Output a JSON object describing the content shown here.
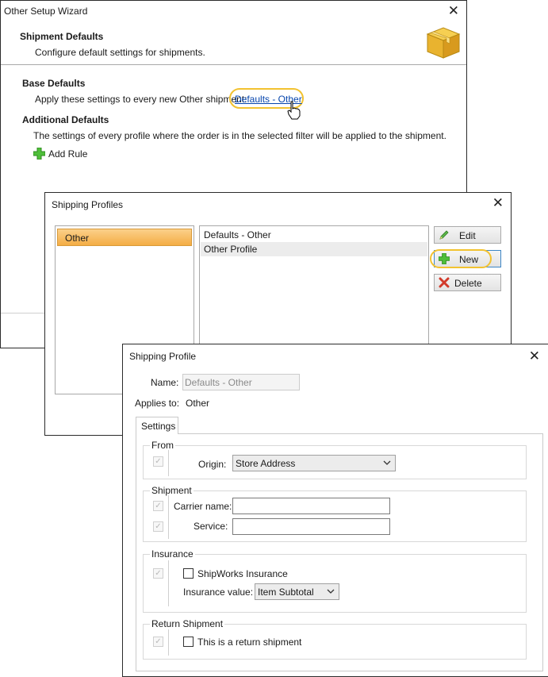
{
  "wizard": {
    "title": "Other Setup Wizard",
    "heading": "Shipment Defaults",
    "subheading": "Configure default settings for shipments.",
    "base_defaults_title": "Base Defaults",
    "base_defaults_text": "Apply these settings to every new Other shipment:",
    "base_defaults_link": "Defaults - Other",
    "additional_defaults_title": "Additional Defaults",
    "additional_defaults_text": "The settings of every profile where the order is in the selected filter will be applied to the shipment.",
    "add_rule_label": "Add Rule"
  },
  "shipping_profiles": {
    "title": "Shipping Profiles",
    "filters": [
      "Other"
    ],
    "profiles": [
      "Defaults - Other",
      "Other Profile"
    ],
    "buttons": {
      "edit": "Edit",
      "new": "New",
      "delete": "Delete"
    }
  },
  "shipping_profile": {
    "title": "Shipping Profile",
    "name_label": "Name:",
    "name_value": "Defaults - Other",
    "applies_to_label": "Applies to:",
    "applies_to_value": "Other",
    "tab_settings": "Settings",
    "from": {
      "title": "From",
      "origin_label": "Origin:",
      "origin_value": "Store Address"
    },
    "shipment": {
      "title": "Shipment",
      "carrier_label": "Carrier name:",
      "carrier_value": "",
      "service_label": "Service:",
      "service_value": ""
    },
    "insurance": {
      "title": "Insurance",
      "shipworks_insurance_label": "ShipWorks Insurance",
      "insurance_value_label": "Insurance value:",
      "insurance_value": "Item Subtotal"
    },
    "return_shipment": {
      "title": "Return Shipment",
      "return_label": "This is a return shipment"
    }
  },
  "colors": {
    "highlight": "#f2c230",
    "link": "#0645ad",
    "selected_filter": "#f7b54a"
  }
}
